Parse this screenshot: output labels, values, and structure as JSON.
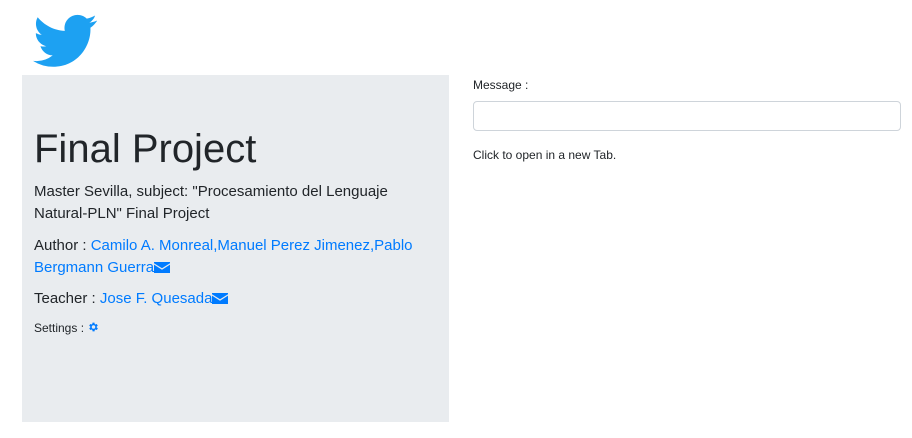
{
  "header": {
    "logo_icon": "twitter-bird-icon",
    "logo_color": "#1da1f2"
  },
  "jumbotron": {
    "title": "Final Project",
    "description": "Master Sevilla, subject: \"Procesamiento del Lenguaje Natural-PLN\" Final Project",
    "author_label": "Author : ",
    "authors_text": "Camilo A. Monreal,Manuel Perez Jimenez,Pablo Bergmann Guerra",
    "teacher_label": "Teacher : ",
    "teacher_text": "Jose F. Quesada",
    "settings_label": "Settings : ",
    "mail_icon": "envelope-icon",
    "settings_icon": "gear-icon",
    "link_color": "#007bff"
  },
  "form": {
    "message_label": "Message :",
    "message_value": "",
    "message_placeholder": "",
    "hint": "Click to open in a new Tab."
  }
}
